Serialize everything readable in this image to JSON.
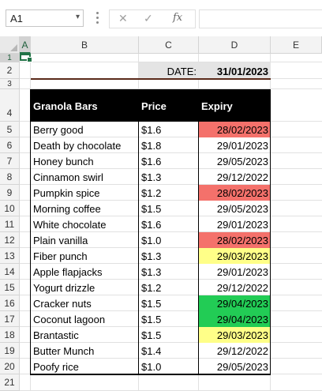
{
  "formula_bar": {
    "name_box": "A1",
    "name_box_arrow": "▾",
    "cancel_glyph": "✕",
    "enter_glyph": "✓",
    "fx_label": "fx",
    "formula": ""
  },
  "columns": [
    "A",
    "B",
    "C",
    "D",
    "E"
  ],
  "rows": [
    "1",
    "2",
    "3",
    "4",
    "5",
    "6",
    "7",
    "8",
    "9",
    "10",
    "11",
    "12",
    "13",
    "14",
    "15",
    "16",
    "17",
    "18",
    "19",
    "20",
    "21"
  ],
  "date_label": "DATE:",
  "date_value": "31/01/2023",
  "headers": {
    "product": "Granola Bars",
    "price": "Price",
    "expiry": "Expiry"
  },
  "status_colors": {
    "expiring": "#f4716b",
    "warning": "#ffff88",
    "ok": "#22cc55",
    "header_bg": "#000000",
    "date_bg": "#e4e4e4"
  },
  "products": [
    {
      "name": "Berry good",
      "price": "$1.6",
      "expiry": "28/02/2023",
      "status": "expiring"
    },
    {
      "name": "Death by chocolate",
      "price": "$1.8",
      "expiry": "29/01/2023",
      "status": ""
    },
    {
      "name": "Honey bunch",
      "price": "$1.6",
      "expiry": "29/05/2023",
      "status": ""
    },
    {
      "name": "Cinnamon swirl",
      "price": "$1.3",
      "expiry": "29/12/2022",
      "status": ""
    },
    {
      "name": "Pumpkin spice",
      "price": "$1.2",
      "expiry": "28/02/2023",
      "status": "expiring"
    },
    {
      "name": "Morning coffee",
      "price": "$1.5",
      "expiry": "29/05/2023",
      "status": ""
    },
    {
      "name": "White chocolate",
      "price": "$1.6",
      "expiry": "29/01/2023",
      "status": ""
    },
    {
      "name": "Plain vanilla",
      "price": "$1.0",
      "expiry": "28/02/2023",
      "status": "expiring"
    },
    {
      "name": "Fiber punch",
      "price": "$1.3",
      "expiry": "29/03/2023",
      "status": "warning"
    },
    {
      "name": "Apple flapjacks",
      "price": "$1.3",
      "expiry": "29/01/2023",
      "status": ""
    },
    {
      "name": "Yogurt drizzle",
      "price": "$1.2",
      "expiry": "29/12/2022",
      "status": ""
    },
    {
      "name": "Cracker nuts",
      "price": "$1.5",
      "expiry": "29/04/2023",
      "status": "ok"
    },
    {
      "name": "Coconut lagoon",
      "price": "$1.5",
      "expiry": "29/04/2023",
      "status": "ok"
    },
    {
      "name": "Brantastic",
      "price": "$1.5",
      "expiry": "29/03/2023",
      "status": "warning"
    },
    {
      "name": "Butter Munch",
      "price": "$1.4",
      "expiry": "29/12/2022",
      "status": ""
    },
    {
      "name": "Poofy rice",
      "price": "$1.0",
      "expiry": "29/05/2023",
      "status": ""
    }
  ]
}
